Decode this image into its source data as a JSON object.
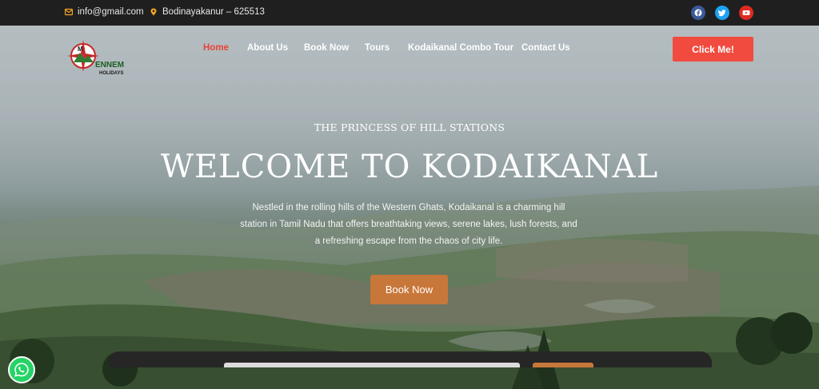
{
  "topbar": {
    "email": "info@gmail.com",
    "location": "Bodinayakanur – 625513",
    "email_icon": "envelope-icon",
    "location_icon": "map-pin-icon",
    "social": [
      {
        "name": "facebook-icon",
        "color": "#3b5998"
      },
      {
        "name": "twitter-icon",
        "color": "#1da1f2"
      },
      {
        "name": "youtube-icon",
        "color": "#e02a20"
      }
    ]
  },
  "brand": {
    "logo_letter": "M",
    "logo_name": "ENNEM",
    "logo_sub": "HOLIDAYS"
  },
  "nav": {
    "items": [
      "Home",
      "About Us",
      "Book Now",
      "Tours",
      "Kodaikanal Combo Tour",
      "Contact Us"
    ],
    "active": "Home",
    "cta_label": "Click Me!"
  },
  "hero": {
    "subtitle": "THE PRINCESS OF HILL STATIONS",
    "title": "WELCOME TO KODAIKANAL",
    "description_lines": [
      "Nestled in the rolling hills of the Western Ghats, Kodaikanal is a charming hill",
      "station in Tamil Nadu that offers breathtaking views, serene lakes, lush forests, and",
      "a refreshing escape from the chaos of city life."
    ],
    "button_label": "Book Now"
  },
  "colors": {
    "accent_red": "#f04b3e",
    "accent_orange": "#c8773a",
    "topbar_bg": "#1f1f1f",
    "icon_orange": "#f5a623"
  },
  "floating": {
    "whatsapp_icon": "whatsapp-icon"
  }
}
